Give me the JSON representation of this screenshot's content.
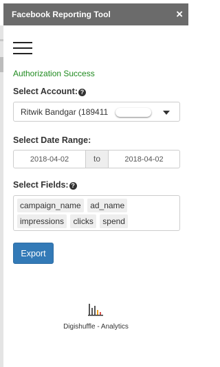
{
  "window": {
    "title": "Facebook Reporting Tool",
    "close_label": "×"
  },
  "menu": {
    "icon": "hamburger-menu-icon"
  },
  "status": {
    "text": "Authorization Success",
    "color": "#1e8a1e"
  },
  "account": {
    "label": "Select Account:",
    "help_icon": "question-circle-icon",
    "selected": "Ritwik Bandgar (189411",
    "selected_suffix": ")"
  },
  "date_range": {
    "label": "Select Date Range:",
    "from": "2018-04-02",
    "separator": "to",
    "to": "2018-04-02"
  },
  "fields": {
    "label": "Select Fields:",
    "help_icon": "question-circle-icon",
    "tags": [
      "campaign_name",
      "ad_name",
      "impressions",
      "clicks",
      "spend"
    ]
  },
  "export": {
    "label": "Export",
    "color": "#337ab7"
  },
  "brand": {
    "text": "Digishuffle - Analytics",
    "logo_icon": "bar-chart-logo-icon"
  }
}
